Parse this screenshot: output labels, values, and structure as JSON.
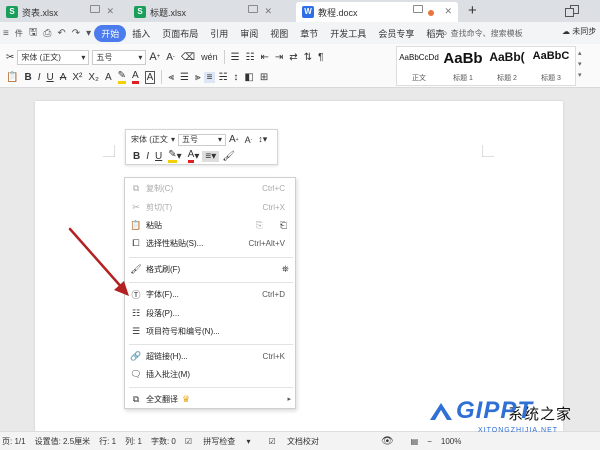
{
  "tabs": [
    {
      "icon": "spreadsheet-icon",
      "color": "#1a9f5b",
      "label": "资表.xlsx"
    },
    {
      "icon": "spreadsheet-icon",
      "color": "#1a9f5b",
      "label": "标题.xlsx"
    },
    {
      "icon": "word-doc-icon",
      "color": "#2e6ee6",
      "label": "教程.docx"
    }
  ],
  "menu": [
    "开始",
    "插入",
    "页面布局",
    "引用",
    "审阅",
    "视图",
    "章节",
    "开发工具",
    "会员专享",
    "稻壳"
  ],
  "search_placeholder": "查找命令、搜索模板",
  "cloud_label": "未同步",
  "ribbon": {
    "font": "宋体 (正文)",
    "size": "五号",
    "styles": [
      {
        "preview": "AaBbCcDd",
        "label": "正文"
      },
      {
        "preview": "AaBb",
        "label": "标题 1"
      },
      {
        "preview": "AaBb(",
        "label": "标题 2"
      },
      {
        "preview": "AaBbC",
        "label": "标题 3"
      }
    ]
  },
  "mini_toolbar": {
    "font": "宋体 (正文",
    "size": "五号"
  },
  "context_menu": [
    {
      "icon": "copy-icon",
      "label": "复制(C)",
      "shortcut": "Ctrl+C",
      "disabled": true
    },
    {
      "icon": "cut-icon",
      "label": "剪切(T)",
      "shortcut": "Ctrl+X",
      "disabled": true
    },
    {
      "icon": "paste-icon",
      "label": "粘贴",
      "shortcut": "",
      "disabled": false
    },
    {
      "icon": "paste-special-icon",
      "label": "选择性粘贴(S)...",
      "shortcut": "Ctrl+Alt+V",
      "disabled": false
    },
    {
      "icon": "format-painter-icon",
      "label": "格式刷(F)",
      "shortcut": "",
      "disabled": false
    },
    {
      "icon": "font-icon",
      "label": "字体(F)...",
      "shortcut": "Ctrl+D",
      "disabled": false
    },
    {
      "icon": "paragraph-icon",
      "label": "段落(P)...",
      "shortcut": "",
      "disabled": false
    },
    {
      "icon": "bullets-icon",
      "label": "项目符号和编号(N)...",
      "shortcut": "",
      "disabled": false
    },
    {
      "icon": "link-icon",
      "label": "超链接(H)...",
      "shortcut": "Ctrl+K",
      "disabled": false
    },
    {
      "icon": "comment-icon",
      "label": "插入批注(M)",
      "shortcut": "",
      "disabled": false
    },
    {
      "icon": "translate-icon",
      "label": "全文翻译",
      "shortcut": "",
      "disabled": false
    }
  ],
  "status": {
    "page": "页: 1/1",
    "setting": "设置值: 2.5厘米",
    "row": "行: 1",
    "col": "列: 1",
    "wordcount": "字数: 0",
    "spellcheck": "拼写检查",
    "proofread": "文档校对",
    "zoom": "100%"
  },
  "watermark": {
    "brand": "GIPPT",
    "site": "XITONGZHIJIA.NET",
    "partial_text": "系统之家"
  },
  "colors": {
    "accent": "#4b7bec",
    "arrow": "#b22222",
    "highlight": "#f5d000",
    "font_color": "#e02020"
  }
}
